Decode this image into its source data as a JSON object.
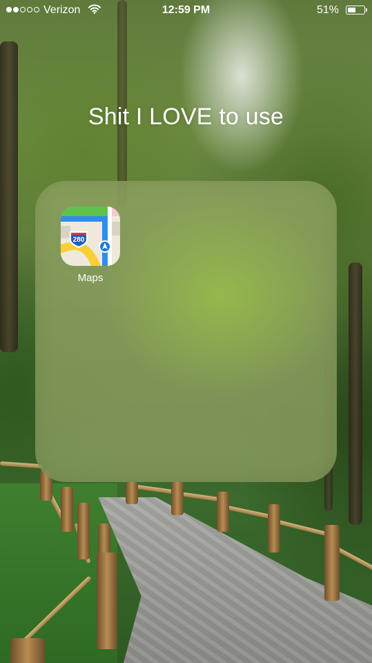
{
  "status_bar": {
    "signal_bars_filled": 2,
    "signal_bars_total": 5,
    "carrier": "Verizon",
    "network_icon": "wifi-icon",
    "time": "12:59 PM",
    "battery_percent_label": "51%",
    "battery_level": 0.51
  },
  "folder": {
    "title": "Shit I LOVE to use",
    "apps": [
      {
        "label": "Maps",
        "icon": "maps-icon",
        "shield_number": "280"
      }
    ]
  },
  "colors": {
    "text": "#ffffff",
    "maps_blue": "#1e7ad8",
    "maps_green": "#5cc24a",
    "maps_yellow": "#f6d036",
    "maps_red": "#e23a32"
  }
}
